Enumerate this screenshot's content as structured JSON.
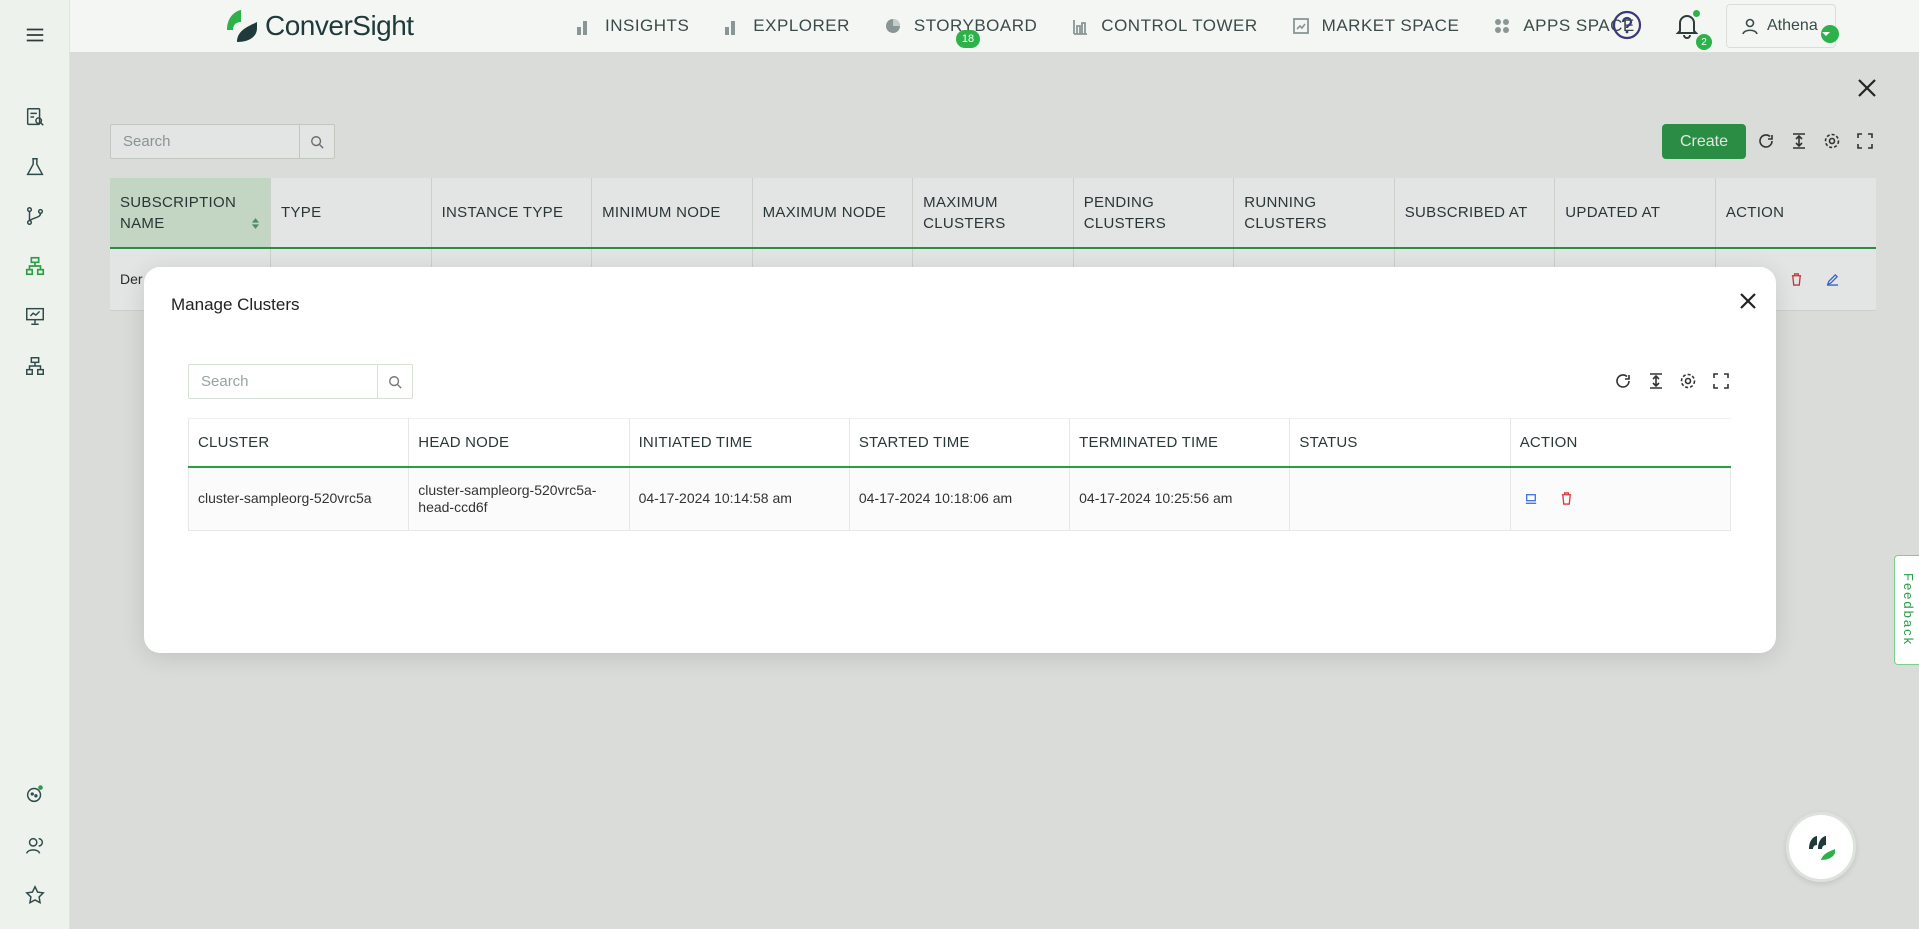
{
  "app": {
    "logo_text": "ConverSight",
    "brand_color": "#2a9d47"
  },
  "nav": {
    "items": [
      {
        "label": "INSIGHTS",
        "icon": "bar-chart-icon"
      },
      {
        "label": "EXPLORER",
        "icon": "bar-chart-icon"
      },
      {
        "label": "STORYBOARD",
        "icon": "pie-icon"
      },
      {
        "label": "CONTROL TOWER",
        "icon": "tower-icon"
      },
      {
        "label": "MARKET SPACE",
        "icon": "store-icon"
      },
      {
        "label": "APPS SPACE",
        "icon": "grid-icon"
      }
    ],
    "storyboard_badge": "18"
  },
  "header": {
    "notification_count": "2",
    "user_name": "Athena"
  },
  "page": {
    "search_placeholder": "Search",
    "create_label": "Create",
    "columns": [
      "SUBSCRIPTION NAME",
      "TYPE",
      "INSTANCE TYPE",
      "MINIMUM NODE",
      "MAXIMUM NODE",
      "MAXIMUM CLUSTERS",
      "PENDING CLUSTERS",
      "RUNNING CLUSTERS",
      "SUBSCRIBED AT",
      "UPDATED AT",
      "ACTION"
    ],
    "row_first_cell": "Der"
  },
  "modal": {
    "title": "Manage Clusters",
    "search_placeholder": "Search",
    "columns": [
      "CLUSTER",
      "HEAD NODE",
      "INITIATED TIME",
      "STARTED TIME",
      "TERMINATED TIME",
      "STATUS",
      "ACTION"
    ],
    "rows": [
      {
        "cluster": "cluster-sampleorg-520vrc5a",
        "head_node": "cluster-sampleorg-520vrc5a-head-ccd6f",
        "initiated": "04-17-2024 10:14:58 am",
        "started": "04-17-2024 10:18:06 am",
        "terminated": "04-17-2024 10:25:56 am",
        "status": ""
      }
    ]
  },
  "feedback_label": "Feedback"
}
